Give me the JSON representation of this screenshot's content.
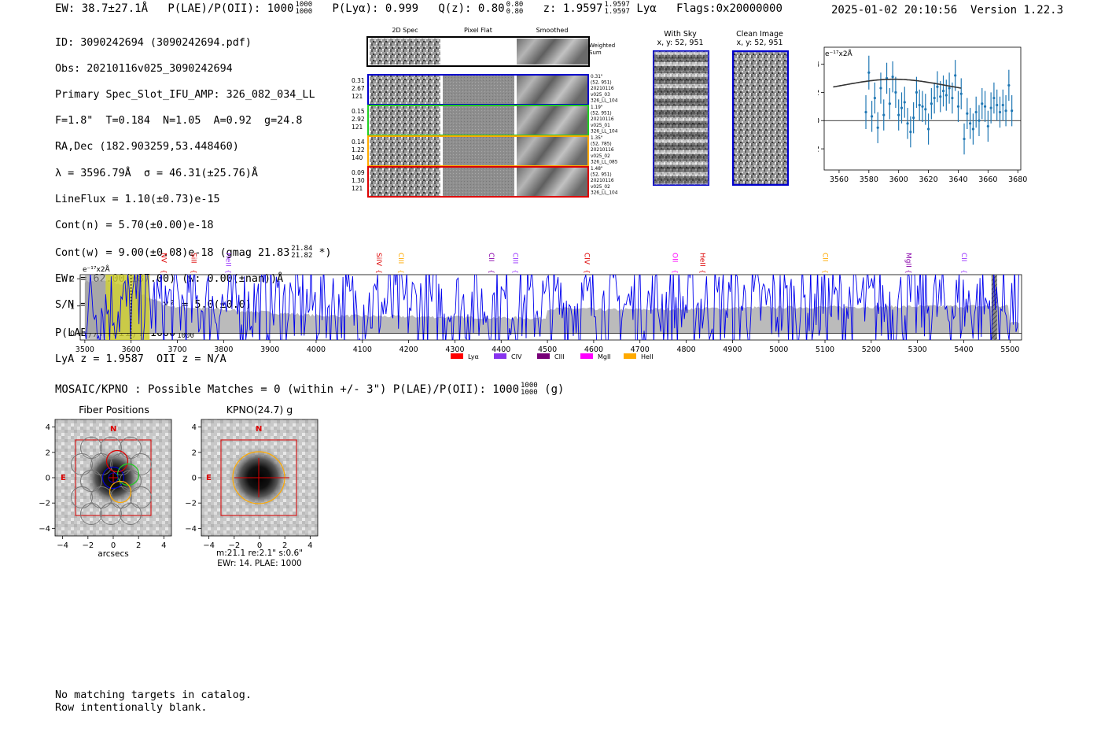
{
  "header": {
    "ew": "EW: 38.7±27.1Å",
    "plae": "P(LAE)/P(OII): 1000",
    "plae_hi": "1000",
    "plae_lo": "1000",
    "plya": "P(Lyα): 0.999",
    "qz": "Q(z): 0.80",
    "qz_hi": "0.80",
    "qz_lo": "0.80",
    "z": "z: 1.9597",
    "z_hi": "1.9597",
    "z_lo": "1.9597",
    "line": "Lyα",
    "flags": "Flags:0x20000000",
    "datetime": "2025-01-02 20:10:56",
    "version": "Version 1.22.3"
  },
  "info": {
    "id": "ID: 3090242694 (3090242694.pdf)",
    "obs": "Obs: 20210116v025_3090242694",
    "primary": "Primary Spec_Slot_IFU_AMP: 326_082_034_LL",
    "params": "F=1.8\"  T=0.184  N=1.05  A=0.92  g=24.8",
    "radec": "RA,Dec (182.903259,53.448460)",
    "lambda": "λ = 3596.79Å  σ = 46.31(±25.76)Å",
    "lineflux": "LineFlux = 1.10(±0.73)e-15",
    "contn": "Cont(n) = 5.70(±0.00)e-18",
    "contw": "Cont(w) = 9.00(±0.08)e-18 (gmag 21.83",
    "contw_hi": "21.84",
    "contw_lo": "21.82",
    "contw_end": "*)",
    "ewr": "EWr = 62.00(±87.00) (w: 0.00(±nan))Å",
    "sn": "S/N = 8.6(±6.0)  χ² = 5.0(±0.0)",
    "plae": "P(LAE)/P(OII): 1000",
    "plae_hi": "1000",
    "plae_lo": "1000",
    "lyaz": "LyA z = 1.9587  OII z = N/A"
  },
  "cutouts": {
    "col_labels": [
      "2D Spec",
      "Pixel Flat",
      "Smoothed"
    ],
    "weighted": "Weighted Sum",
    "rows": [
      {
        "left": [
          "0.31",
          "2.67",
          "121"
        ],
        "right": [
          "0.31\"",
          "(52, 951)",
          "20210116",
          "v025_03",
          "326_LL_104"
        ],
        "color": "#0000cc"
      },
      {
        "left": [
          "0.15",
          "2.92",
          "121"
        ],
        "right": [
          "1.19\"",
          "(52, 951)",
          "20210116",
          "v025_01",
          "326_LL_104"
        ],
        "color": "#22cc22"
      },
      {
        "left": [
          "0.14",
          "1.22",
          "140"
        ],
        "right": [
          "1.35\"",
          "(52, 785)",
          "20210116",
          "v025_02",
          "326_LL_085"
        ],
        "color": "#ffaa00"
      },
      {
        "left": [
          "0.09",
          "1.30",
          "121"
        ],
        "right": [
          "1.48\"",
          "(52, 951)",
          "20210116",
          "v025_02",
          "326_LL_104"
        ],
        "color": "#dd0000"
      }
    ]
  },
  "sky": {
    "with_sky": "With Sky",
    "with_sky_xy": "x, y: 52, 951",
    "clean": "Clean Image",
    "clean_xy": "x, y: 52, 951"
  },
  "zoom_plot": {
    "ylabel": "e⁻¹⁷x2Å",
    "xticks": [
      "3560",
      "3580",
      "3600",
      "3620",
      "3640",
      "3660",
      "3680"
    ],
    "yticks": [
      "4",
      "2",
      "0",
      "−2"
    ]
  },
  "spectrum": {
    "ylabel": "e⁻¹⁷x2Å",
    "yticks": [
      "2",
      "1",
      "0"
    ],
    "xticks": [
      "3500",
      "3600",
      "3700",
      "3800",
      "3900",
      "4000",
      "4100",
      "4200",
      "4300",
      "4400",
      "4500",
      "4600",
      "4700",
      "4800",
      "4900",
      "5000",
      "5100",
      "5200",
      "5300",
      "5400",
      "5500"
    ],
    "lines": [
      {
        "name": "NV",
        "wave": 3670,
        "color": "#dd0000"
      },
      {
        "name": "SiII",
        "wave": 3735,
        "color": "#dd0000"
      },
      {
        "name": "HeII",
        "wave": 3810,
        "color": "#9933ff"
      },
      {
        "name": "SiIV",
        "wave": 4135,
        "color": "#dd0000"
      },
      {
        "name": "CIII",
        "wave": 4183,
        "color": "#ffaa00"
      },
      {
        "name": "CII",
        "wave": 4378,
        "color": "#8800aa"
      },
      {
        "name": "CIII",
        "wave": 4430,
        "color": "#9933ff"
      },
      {
        "name": "CIV",
        "wave": 4585,
        "color": "#dd0000"
      },
      {
        "name": "OII",
        "wave": 4775,
        "color": "#ff00ff"
      },
      {
        "name": "HeII",
        "wave": 4835,
        "color": "#dd0000"
      },
      {
        "name": "CII",
        "wave": 5100,
        "color": "#ffaa00"
      },
      {
        "name": "MgII",
        "wave": 5280,
        "color": "#8800aa"
      },
      {
        "name": "CII",
        "wave": 5400,
        "color": "#9933ff"
      }
    ],
    "legend": [
      {
        "name": "Lyα",
        "color": "#ff0000"
      },
      {
        "name": "CIV",
        "color": "#8833ee"
      },
      {
        "name": "CIII",
        "color": "#770077"
      },
      {
        "name": "MgII",
        "color": "#ff00ff"
      },
      {
        "name": "HeII",
        "color": "#ffaa00"
      }
    ]
  },
  "catalog": {
    "title": "MOSAIC/KPNO : Possible Matches = 0 (within +/- 3\")  P(LAE)/P(OII): 1000",
    "plae_hi": "1000",
    "plae_lo": "1000",
    "band": "(g)",
    "fiber_title": "Fiber Positions",
    "kpno_title": "KPNO(24.7) g",
    "ticks": [
      "−4",
      "−2",
      "0",
      "2",
      "4"
    ],
    "xlabel": "arcsecs",
    "north": "N",
    "east": "E",
    "meta1": "m:21.1  re:2.1\"  s:0.6\"",
    "meta2": "EWr: 14. PLAE: 1000"
  },
  "footer": {
    "line1": "No matching targets in catalog.",
    "line2": "Row intentionally blank."
  },
  "chart_data": [
    {
      "type": "scatter",
      "xlabel": "",
      "ylabel": "e⁻¹⁷x2Å",
      "xlim": [
        3550,
        3682
      ],
      "ylim": [
        -3.5,
        5.2
      ],
      "x": [
        3578,
        3580,
        3582,
        3584,
        3586,
        3588,
        3590,
        3592,
        3594,
        3596,
        3598,
        3600,
        3602,
        3604,
        3606,
        3608,
        3610,
        3612,
        3614,
        3616,
        3618,
        3620,
        3622,
        3624,
        3626,
        3628,
        3630,
        3632,
        3634,
        3636,
        3638,
        3640,
        3642,
        3644,
        3646,
        3648,
        3650,
        3652,
        3654,
        3656,
        3658,
        3660,
        3662,
        3664,
        3666,
        3668,
        3670,
        3672,
        3674,
        3676
      ],
      "values": [
        0.6,
        3.4,
        0.3,
        1.6,
        -0.5,
        2.3,
        0.4,
        3.0,
        1.2,
        3.1,
        2.0,
        0.4,
        0.9,
        1.3,
        -0.2,
        -0.8,
        0.2,
        2.0,
        1.1,
        1.0,
        0.8,
        -0.6,
        1.2,
        1.6,
        2.4,
        1.7,
        2.1,
        1.8,
        2.3,
        1.6,
        3.2,
        1.0,
        1.9,
        -1.3,
        0.5,
        -0.2,
        -0.6,
        0.6,
        0.0,
        1.2,
        1.0,
        -0.4,
        0.9,
        1.6,
        1.1,
        0.6,
        1.1,
        0.7,
        2.5,
        0.7
      ],
      "errors": [
        1.2,
        1.2,
        1.1,
        1.1,
        1.1,
        1.1,
        1.1,
        1.1,
        1.1,
        1.1,
        1.1,
        1.1,
        1.1,
        1.1,
        1.1,
        1.1,
        1.1,
        1.1,
        1.1,
        1.1,
        1.1,
        1.1,
        1.1,
        1.1,
        1.1,
        1.1,
        1.1,
        1.1,
        1.1,
        1.1,
        1.1,
        1.1,
        1.1,
        1.1,
        1.1,
        1.1,
        1.1,
        1.1,
        1.1,
        1.1,
        1.1,
        1.1,
        1.1,
        1.1,
        1.1,
        1.1,
        1.1,
        1.1,
        1.1,
        1.1
      ],
      "fit": {
        "center": 3596.79,
        "sigma": 46.31,
        "amp": 1.1,
        "base": 1.83,
        "xrange": [
          3556,
          3642
        ]
      }
    },
    {
      "type": "line",
      "xlabel": "",
      "ylabel": "e⁻¹⁷x2Å",
      "xlim": [
        3490,
        5525
      ],
      "ylim": [
        -0.25,
        2.15
      ],
      "series": [
        {
          "color": "#0000ee"
        },
        {
          "color": "#bbbbbb"
        }
      ]
    }
  ]
}
